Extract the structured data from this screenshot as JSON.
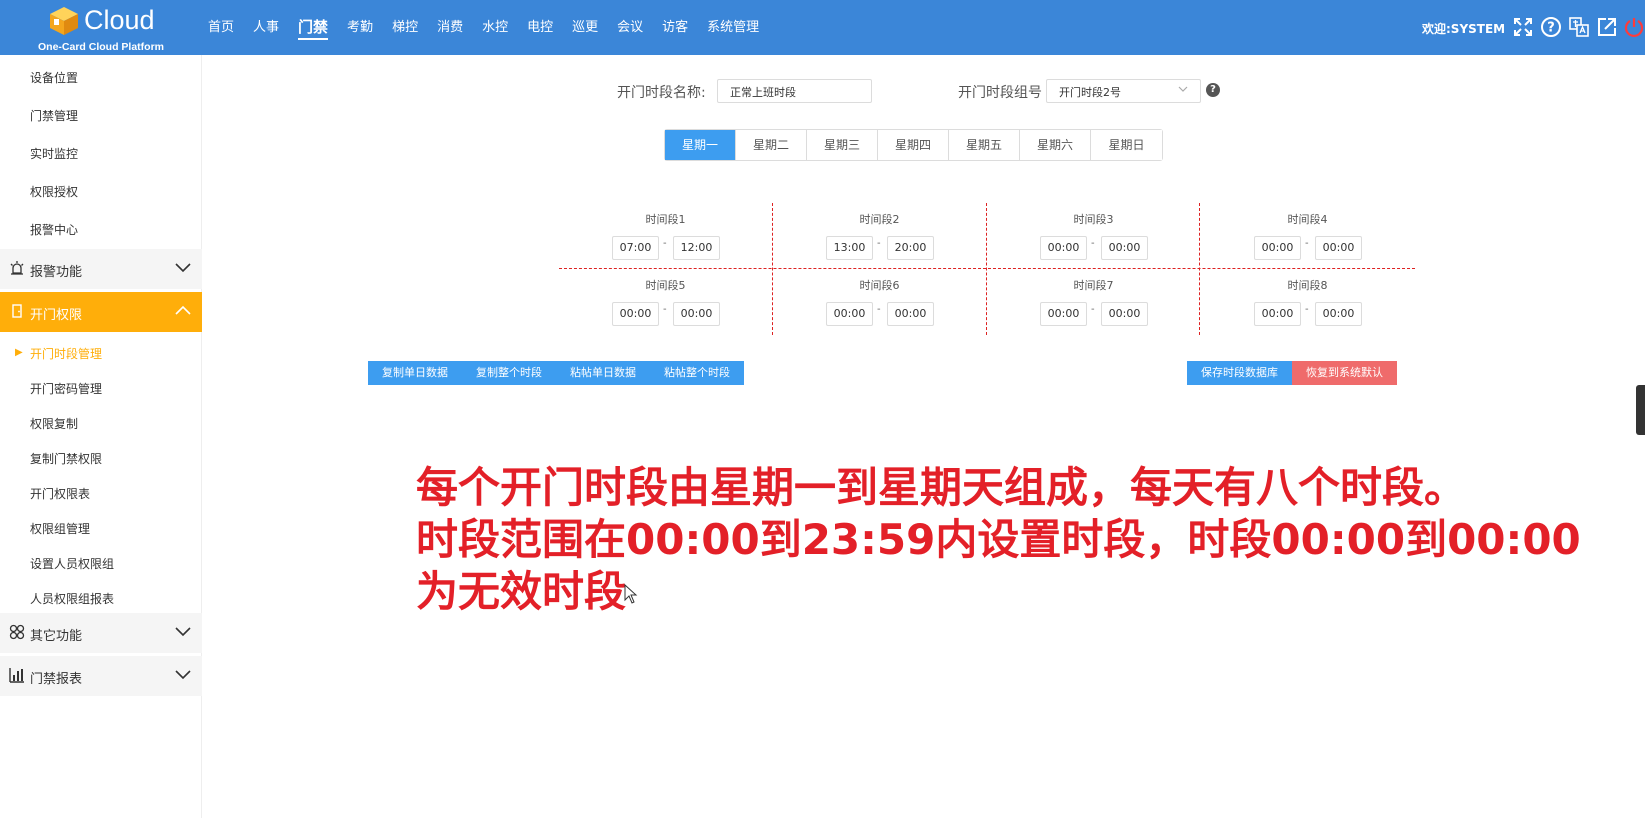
{
  "header": {
    "logo_text": "Cloud",
    "logo_subtitle": "One-Card Cloud Platform",
    "nav": [
      "首页",
      "人事",
      "门禁",
      "考勤",
      "梯控",
      "消费",
      "水控",
      "电控",
      "巡更",
      "会议",
      "访客",
      "系统管理"
    ],
    "active_nav": "门禁",
    "welcome": "欢迎:SYSTEM"
  },
  "sidebar": {
    "top_items": [
      "设备位置",
      "门禁管理",
      "实时监控",
      "权限授权",
      "报警中心"
    ],
    "alarm_group": "报警功能",
    "access_group": "开门权限",
    "access_items": [
      "开门时段管理",
      "开门密码管理",
      "权限复制",
      "复制门禁权限",
      "开门权限表",
      "权限组管理",
      "设置人员权限组",
      "人员权限组报表"
    ],
    "other_group": "其它功能",
    "report_group": "门禁报表"
  },
  "form": {
    "name_label": "开门时段名称:",
    "name_value": "正常上班时段",
    "group_label": "开门时段组号",
    "group_value": "开门时段2号"
  },
  "tabs": [
    "星期一",
    "星期二",
    "星期三",
    "星期四",
    "星期五",
    "星期六",
    "星期日"
  ],
  "active_tab": "星期一",
  "slots": [
    {
      "title": "时间段1",
      "start": "07:00",
      "end": "12:00"
    },
    {
      "title": "时间段2",
      "start": "13:00",
      "end": "20:00"
    },
    {
      "title": "时间段3",
      "start": "00:00",
      "end": "00:00"
    },
    {
      "title": "时间段4",
      "start": "00:00",
      "end": "00:00"
    },
    {
      "title": "时间段5",
      "start": "00:00",
      "end": "00:00"
    },
    {
      "title": "时间段6",
      "start": "00:00",
      "end": "00:00"
    },
    {
      "title": "时间段7",
      "start": "00:00",
      "end": "00:00"
    },
    {
      "title": "时间段8",
      "start": "00:00",
      "end": "00:00"
    }
  ],
  "slot_separator": "-",
  "buttons": {
    "copy_day": "复制单日数据",
    "copy_all": "复制整个时段",
    "paste_day": "粘帖单日数据",
    "paste_all": "粘帖整个时段",
    "save": "保存时段数据库",
    "restore": "恢复到系统默认"
  },
  "caption": {
    "line1": "每个开门时段由星期一到星期天组成，每天有八个时段。",
    "line2": "时段范围在00:00到23:59内设置时段，时段00:00到00:00",
    "line3": "为无效时段"
  },
  "colors": {
    "header_bg": "#3b86d8",
    "accent_orange": "#ffae0a",
    "button_blue": "#3d9df0",
    "button_red": "#ef6b6b",
    "caption_red": "#e32028"
  }
}
